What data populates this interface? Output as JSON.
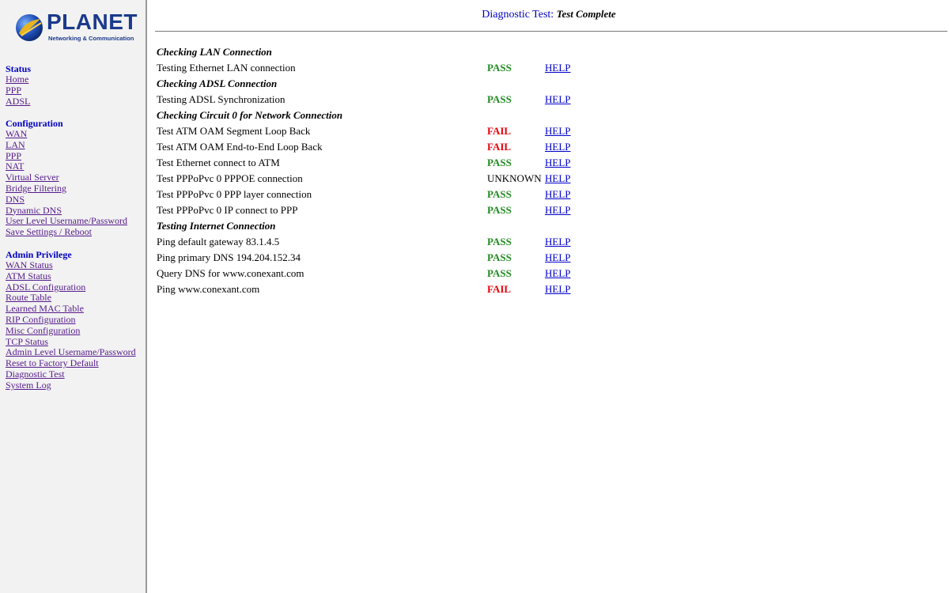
{
  "logo": {
    "brand": "PLANET",
    "tagline": "Networking & Communication"
  },
  "nav": {
    "status": {
      "heading": "Status",
      "links": [
        "Home",
        "PPP",
        "ADSL"
      ]
    },
    "configuration": {
      "heading": "Configuration",
      "links": [
        "WAN",
        "LAN",
        "PPP",
        "NAT",
        "Virtual Server",
        "Bridge Filtering",
        "DNS",
        "Dynamic DNS",
        "User Level Username/Password",
        "Save Settings / Reboot"
      ]
    },
    "admin": {
      "heading": "Admin Privilege",
      "links": [
        "WAN Status",
        "ATM Status",
        "ADSL Configuration",
        "Route Table",
        "Learned MAC Table",
        "RIP Configuration",
        "Misc Configuration",
        "TCP Status",
        "Admin Level Username/Password",
        "Reset to Factory Default",
        "Diagnostic Test",
        "System Log"
      ]
    }
  },
  "header": {
    "title_label": "Diagnostic Test:",
    "title_status": "Test Complete"
  },
  "colors": {
    "pass": "#228b22",
    "fail": "#e8000b",
    "unknown": "#000000"
  },
  "results": {
    "help_label": "HELP",
    "sections": [
      {
        "title": "Checking LAN Connection",
        "tests": [
          {
            "name": "Testing Ethernet LAN connection",
            "result": "PASS"
          }
        ]
      },
      {
        "title": "Checking ADSL Connection",
        "tests": [
          {
            "name": "Testing ADSL Synchronization",
            "result": "PASS"
          }
        ]
      },
      {
        "title": "Checking Circuit 0 for Network Connection",
        "tests": [
          {
            "name": "Test ATM OAM Segment Loop Back",
            "result": "FAIL"
          },
          {
            "name": "Test ATM OAM End-to-End Loop Back",
            "result": "FAIL"
          },
          {
            "name": "Test Ethernet connect to ATM",
            "result": "PASS"
          },
          {
            "name": "Test PPPoPvc 0 PPPOE connection",
            "result": "UNKNOWN"
          },
          {
            "name": "Test PPPoPvc 0 PPP layer connection",
            "result": "PASS"
          },
          {
            "name": "Test PPPoPvc 0 IP connect to PPP",
            "result": "PASS"
          }
        ]
      },
      {
        "title": "Testing Internet Connection",
        "tests": [
          {
            "name": "Ping default gateway 83.1.4.5",
            "result": "PASS"
          },
          {
            "name": "Ping primary DNS 194.204.152.34",
            "result": "PASS"
          },
          {
            "name": "Query DNS for www.conexant.com",
            "result": "PASS"
          },
          {
            "name": "Ping www.conexant.com",
            "result": "FAIL"
          }
        ]
      }
    ]
  }
}
